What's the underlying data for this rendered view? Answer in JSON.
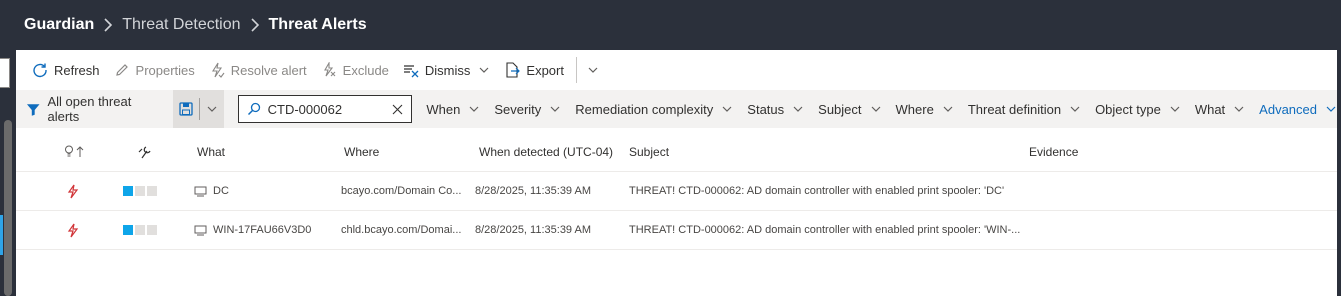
{
  "breadcrumb": [
    "Guardian",
    "Threat Detection",
    "Threat Alerts"
  ],
  "toolbar": {
    "refresh": "Refresh",
    "properties": "Properties",
    "resolve": "Resolve alert",
    "exclude": "Exclude",
    "dismiss": "Dismiss",
    "export": "Export"
  },
  "filterbar": {
    "favorite": "All open threat alerts",
    "search_value": "CTD-000062",
    "filters": [
      "When",
      "Severity",
      "Remediation complexity",
      "Status",
      "Subject",
      "Where",
      "Threat definition",
      "Object type",
      "What"
    ],
    "advanced": "Advanced"
  },
  "table": {
    "headers": {
      "what": "What",
      "where": "Where",
      "when": "When detected (UTC-04)",
      "subject": "Subject",
      "evidence": "Evidence"
    },
    "rows": [
      {
        "what": "DC",
        "where": "bcayo.com/Domain Co...",
        "when": "8/28/2025, 11:35:39 AM",
        "subject": "THREAT! CTD-000062: AD domain controller with enabled print spooler: 'DC'",
        "severity": 1
      },
      {
        "what": "WIN-17FAU66V3D0",
        "where": "chld.bcayo.com/Domai...",
        "when": "8/28/2025, 11:35:39 AM",
        "subject": "THREAT! CTD-000062: AD domain controller with enabled print spooler: 'WIN-...",
        "severity": 1
      }
    ]
  },
  "colors": {
    "accent": "#0f6cbd",
    "threat": "#d13438",
    "severity": "#0ea5e9",
    "header_bg": "#2b303b"
  }
}
